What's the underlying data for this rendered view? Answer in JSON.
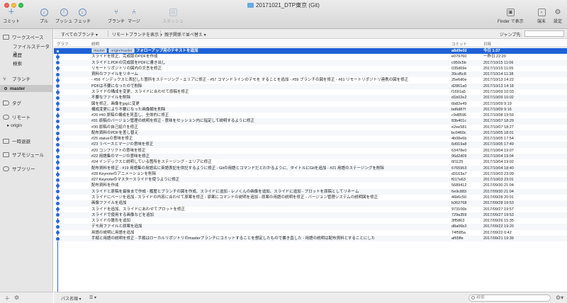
{
  "window": {
    "title": "20171021_DTP東京 (Git)"
  },
  "toolbar": {
    "commit": "コミット",
    "pull": "プル",
    "push": "プッシュ",
    "fetch": "フェッチ",
    "branch": "ブランチ",
    "merge": "マージ",
    "stash": "スタッシュ",
    "finder": "Finder で表示",
    "terminal": "端末",
    "settings": "設定"
  },
  "sidebar": {
    "workspace": "ワークスペース",
    "file_status": "ファイルステータス",
    "history": "履歴",
    "search": "検索",
    "branches": "ブランチ",
    "current_branch": "master",
    "tags": "タグ",
    "remotes": "リモート",
    "remote_origin": "origin",
    "stashes": "一時退避",
    "submodules": "サブモジュール",
    "subtrees": "サブツリー"
  },
  "filters": {
    "branches": "すべてのブランチ",
    "remote": "リモートブランチを表示",
    "order": "親子関係で並べ替え",
    "jump": "ジャンプ先:"
  },
  "columns": {
    "graph": "グラフ",
    "description": "説明",
    "commit": "コミット",
    "date": "日時"
  },
  "commits": [
    {
      "tags": [
        "master",
        "origin/master"
      ],
      "msg": "フォローアップ用のテキストを追加",
      "sha": "a8d9e02",
      "date": "今日 1:37"
    },
    {
      "msg": "スライドを修正、完成版のPDFを作成",
      "sha": "e079760",
      "date": "一昨日 22:20"
    },
    {
      "msg": "スライドとPDFの完成版をPDFに書き出し",
      "sha": "c950c5b",
      "date": "2017/10/15 11:06"
    },
    {
      "msg": "リモートリポジトリの図内の文言を修正",
      "sha": "035d69e",
      "date": "2017/10/15 11:05"
    },
    {
      "msg": "資料のファイルをリネーム",
      "sha": "39cd5c8",
      "date": "2017/10/14 11:38"
    },
    {
      "msg": "- #56 インデックスと表記した箇所をステージング・エリアに修正 - #57 コマンドラインのデモを することを追加 - #59 ブランチの図を修正 - #61 リモートリポジトリ連携の図を修正",
      "sha": "25e6d0e",
      "date": "2017/10/13 14:22"
    },
    {
      "msg": "PDFは不要になったので削除",
      "sha": "d2861a0",
      "date": "2017/10/13 14:18"
    },
    {
      "msg": "スライドの構成を変更、スライドに合わせて原稿を修正",
      "sha": "f1691a5",
      "date": "2017/10/09 10:03"
    },
    {
      "msg": "不要なファイルを削除",
      "sha": "d1b02e2",
      "date": "2017/10/09 10:02"
    },
    {
      "msg": "図を修正、画像をjpgに変更",
      "sha": "6b82e49",
      "date": "2017/10/09 9:19"
    },
    {
      "msg": "構成変更により不要になった画像類を削除",
      "sha": "bd6d87f",
      "date": "2017/10/09 9:16"
    },
    {
      "msg": "#26 #40 原稿の構成を見直し、全体的に修正",
      "sha": "c9d8596",
      "date": "2017/10/08 19:59"
    },
    {
      "msg": "#31 原稿のバージョン管理の説明を修正 - 意味をセッション内に指定して説明するように修正",
      "sha": "83b401c",
      "date": "2017/10/07 18:29"
    },
    {
      "msg": "#30 原稿の自己紹介を修正",
      "sha": "e2ee581",
      "date": "2017/10/07 18:27"
    },
    {
      "msg": "配布資料のPDFを差し替え",
      "sha": "bc0460c",
      "date": "2017/10/05 18:01"
    },
    {
      "msg": "#25 statusの意味を修正",
      "sha": "4b08e6b",
      "date": "2017/10/05 17:54"
    },
    {
      "msg": "#23 リベースとマージの意味を修正",
      "sha": "6d919a8",
      "date": "2017/10/05 17:49"
    },
    {
      "msg": "#20 コンフリクトの意味を修正",
      "sha": "63478e0",
      "date": "2017/10/04 19:07"
    },
    {
      "msg": "#22 用語集のマージの意味を修正",
      "sha": "96d2d09",
      "date": "2017/10/04 19:04"
    },
    {
      "msg": "#24 インデックスと説明している箇所をステージング・エリアに修正",
      "sha": "6f1125",
      "date": "2017/10/04 19:02"
    },
    {
      "msg": "配布資料を修正 - #19 用語集の用語名に英語表記を併記するように修正 - Gitの用語とコマンドだとわかるように、タイトルにGitを追加 - #21 用語のステージングを削除",
      "sha": "6765953",
      "date": "2017/10/04 18:40"
    },
    {
      "msg": "#28 Keynoteのアニメーションを削除",
      "sha": "d3163a7",
      "date": "2017/10/03 23:09"
    },
    {
      "msg": "#27 Keynoteのマスタースライドを使うように修正",
      "sha": "f017e63",
      "date": "2017/10/03 23:01"
    },
    {
      "msg": "配布資料を作成",
      "sha": "5689412",
      "date": "2017/09/30 21:04"
    },
    {
      "msg": "スライドと原稿を最後まで作成 - 履歴とブランチの図を作成、スライドに追加 - レノくんの画像を追加、スライドに追加 - プロットを原稿としてリネーム",
      "sha": "6e9c883",
      "date": "2017/09/30 21:04"
    },
    {
      "msg": "スライドにページを追加 - スライドの内容に合わせて原案を修正 - 原案にコマンドの説明を追加 - 原案の用語の説明を修正 - バージョン管理システムの説明図を修正",
      "sha": "46b6c50",
      "date": "2017/09/28 20:01"
    },
    {
      "msg": "画像ファイルを追加",
      "sha": "b362768",
      "date": "2017/09/28 19:53"
    },
    {
      "msg": "スライドを追加、スライドにあわせてプロットを修正",
      "sha": "973106b",
      "date": "2017/09/27 19:57"
    },
    {
      "msg": "スライドで使用する画像などを追加",
      "sha": "729a359",
      "date": "2017/09/27 19:53"
    },
    {
      "msg": "スライドの雛形を追加",
      "sha": "3ff5863",
      "date": "2017/09/26 15:35"
    },
    {
      "msg": "デモ用ファイルと原案を追加",
      "sha": "d8a06b3",
      "date": "2017/09/22 19:20"
    },
    {
      "msg": "用語の説明に用語を追加",
      "sha": "74f585a",
      "date": "2017/09/22 0:42"
    },
    {
      "msg": "手順と用語の説明を修正 - 手順はローカルリポジトリのmasterブランチにコミットすることを想定したもので書き直した - 用語の説明は配布資料とすることにした",
      "sha": "af65ffe",
      "date": "2017/09/21 19:39"
    }
  ],
  "bottombar": {
    "path_label": "パス名順",
    "search_placeholder": "検索"
  },
  "colors": {
    "accent": "#1f62d6",
    "graph": "#2a66d9"
  }
}
